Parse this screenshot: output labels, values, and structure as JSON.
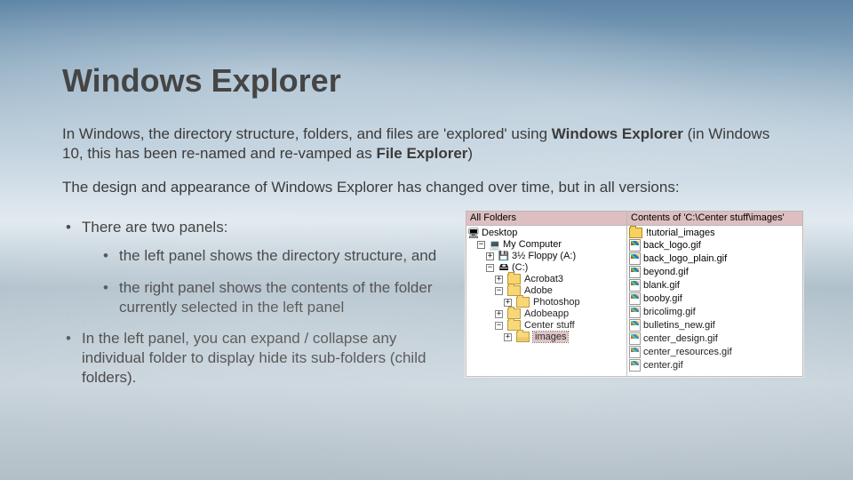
{
  "title": "Windows Explorer",
  "intro": {
    "pre": "In Windows, the directory structure, folders, and files are 'explored' using ",
    "strong1": "Windows Explorer",
    "mid": " (in Windows 10, this has been re-named and re-vamped as ",
    "strong2": "File Explorer",
    "post": ")"
  },
  "para2": "The design and appearance of Windows Explorer has changed over time, but in all versions:",
  "bullets": {
    "b1": "There are two panels:",
    "b1a": "the left panel shows the directory structure, and",
    "b1b": "the right panel shows the contents of the folder currently selected in the left panel",
    "b2": "In the left panel, you can expand / collapse any individual folder to display hide its sub-folders (child folders)."
  },
  "explorer": {
    "leftHeader": "All Folders",
    "rightHeader": "Contents of 'C:\\Center stuff\\images'",
    "tree": {
      "desktop": "Desktop",
      "mycomputer": "My Computer",
      "floppy": "3½ Floppy (A:)",
      "cdrive": "(C:)",
      "acrobat3": "Acrobat3",
      "adobe": "Adobe",
      "photoshop": "Photoshop",
      "adobeapp": "Adobeapp",
      "centerstuff": "Center stuff",
      "images": "images"
    },
    "files": [
      "!tutorial_images",
      "back_logo.gif",
      "back_logo_plain.gif",
      "beyond.gif",
      "blank.gif",
      "booby.gif",
      "bricolimg.gif",
      "bulletins_new.gif",
      "center_design.gif",
      "center_resources.gif",
      "center.gif"
    ]
  }
}
